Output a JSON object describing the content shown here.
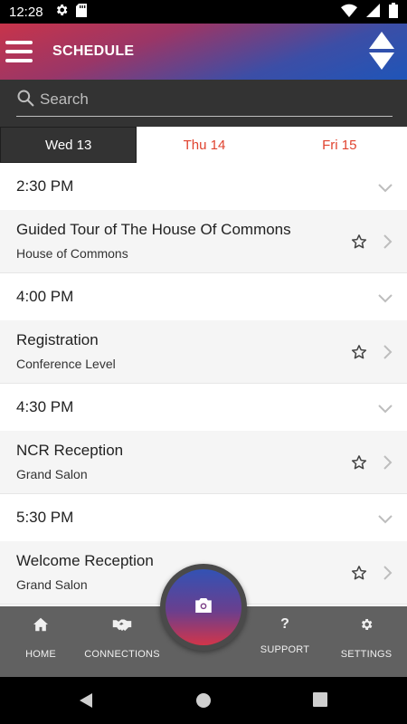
{
  "status_bar": {
    "time": "12:28"
  },
  "app_bar": {
    "title": "SCHEDULE"
  },
  "search": {
    "placeholder": "Search"
  },
  "tabs": [
    {
      "label": "Wed 13",
      "active": true
    },
    {
      "label": "Thu 14",
      "active": false
    },
    {
      "label": "Fri 15",
      "active": false
    }
  ],
  "schedule": [
    {
      "time": "2:30 PM",
      "event": {
        "title": "Guided Tour of The House Of Commons",
        "location": "House of Commons"
      }
    },
    {
      "time": "4:00 PM",
      "event": {
        "title": "Registration",
        "location": "Conference Level"
      }
    },
    {
      "time": "4:30 PM",
      "event": {
        "title": "NCR Reception",
        "location": "Grand Salon"
      }
    },
    {
      "time": "5:30 PM",
      "event": {
        "title": "Welcome Reception",
        "location": "Grand Salon"
      }
    }
  ],
  "bottom_nav": {
    "home": "HOME",
    "connections": "CONNECTIONS",
    "support": "SUPPORT",
    "settings": "SETTINGS"
  },
  "icons": {
    "status": [
      "gear-icon",
      "sd-card-icon",
      "wifi-icon",
      "signal-icon",
      "battery-icon"
    ],
    "app_bar": [
      "menu-icon",
      "sort-icon"
    ],
    "fab": "camera-icon"
  },
  "colors": {
    "accent": "#e0432f",
    "dark_bar": "#333333",
    "nav_bg": "#616161"
  }
}
